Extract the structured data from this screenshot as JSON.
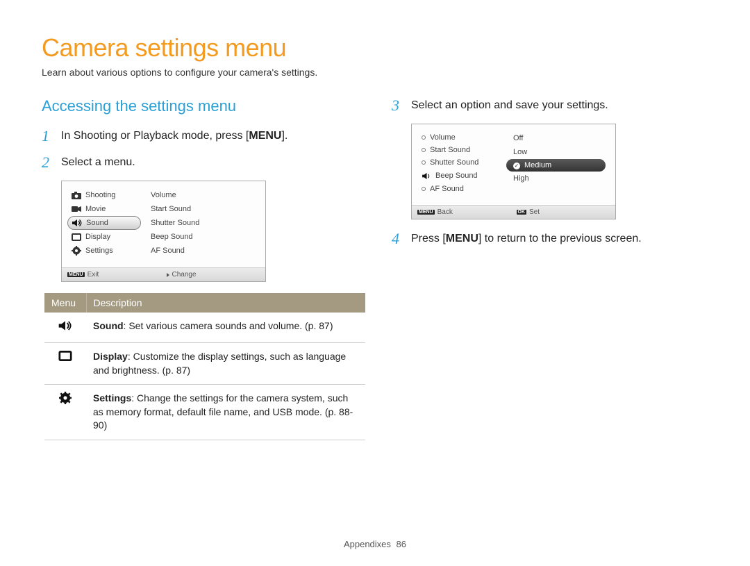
{
  "title": "Camera settings menu",
  "subtitle": "Learn about various options to configure your camera's settings.",
  "section_heading": "Accessing the settings menu",
  "steps": {
    "s1_pre": "In Shooting or Playback mode, press [",
    "s1_btn": "MENU",
    "s1_post": "].",
    "s2": "Select a menu.",
    "s3": "Select an option and save your settings.",
    "s4_pre": "Press [",
    "s4_btn": "MENU",
    "s4_post": "] to return to the previous screen."
  },
  "step_nums": {
    "n1": "1",
    "n2": "2",
    "n3": "3",
    "n4": "4"
  },
  "menu1": {
    "left": {
      "shooting": "Shooting",
      "movie": "Movie",
      "sound": "Sound",
      "display": "Display",
      "settings": "Settings"
    },
    "right": {
      "volume": "Volume",
      "start_sound": "Start Sound",
      "shutter_sound": "Shutter Sound",
      "beep_sound": "Beep Sound",
      "af_sound": "AF Sound"
    },
    "bar": {
      "left_tag": "MENU",
      "left_label": "Exit",
      "right_label": "Change"
    }
  },
  "menu2": {
    "left": {
      "volume": "Volume",
      "start_sound": "Start Sound",
      "shutter_sound": "Shutter Sound",
      "beep_sound": "Beep Sound",
      "af_sound": "AF Sound"
    },
    "right": {
      "off": "Off",
      "low": "Low",
      "medium": "Medium",
      "high": "High"
    },
    "bar": {
      "left_tag": "MENU",
      "left_label": "Back",
      "right_tag": "OK",
      "right_label": "Set"
    }
  },
  "table": {
    "head_menu": "Menu",
    "head_desc": "Description",
    "row1_bold": "Sound",
    "row1_rest": ": Set various camera sounds and volume. (p. 87)",
    "row2_bold": "Display",
    "row2_rest": ": Customize the display settings, such as language and brightness. (p. 87)",
    "row3_bold": "Settings",
    "row3_rest": ": Change the settings for the camera system, such as memory format, default file name, and USB mode. (p. 88-90)"
  },
  "footer": {
    "label": "Appendixes",
    "page": "86"
  }
}
